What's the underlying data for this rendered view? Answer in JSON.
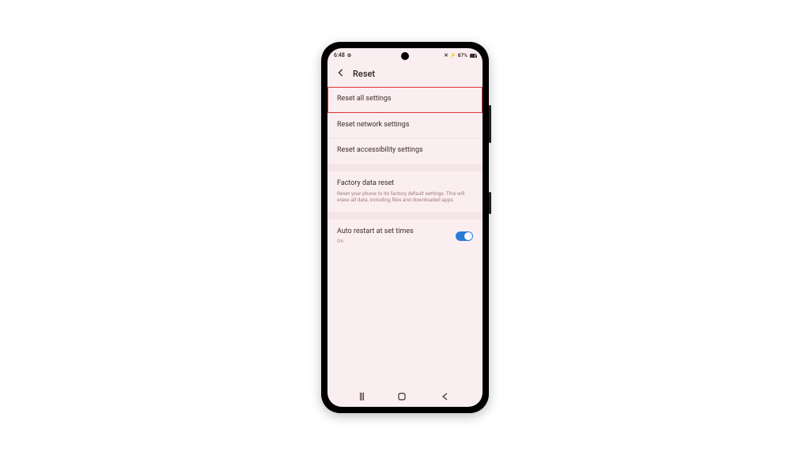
{
  "statusbar": {
    "time": "6:48",
    "battery_pct": "87%",
    "vibrate_glyph": "✕",
    "charge_glyph": "⚡"
  },
  "header": {
    "title": "Reset"
  },
  "items": {
    "reset_all": "Reset all settings",
    "reset_network": "Reset network settings",
    "reset_accessibility": "Reset accessibility settings",
    "factory": {
      "title": "Factory data reset",
      "sub": "Reset your phone to its factory default settings. This will erase all data, including files and downloaded apps."
    },
    "auto_restart": {
      "title": "Auto restart at set times",
      "state": "On"
    }
  }
}
